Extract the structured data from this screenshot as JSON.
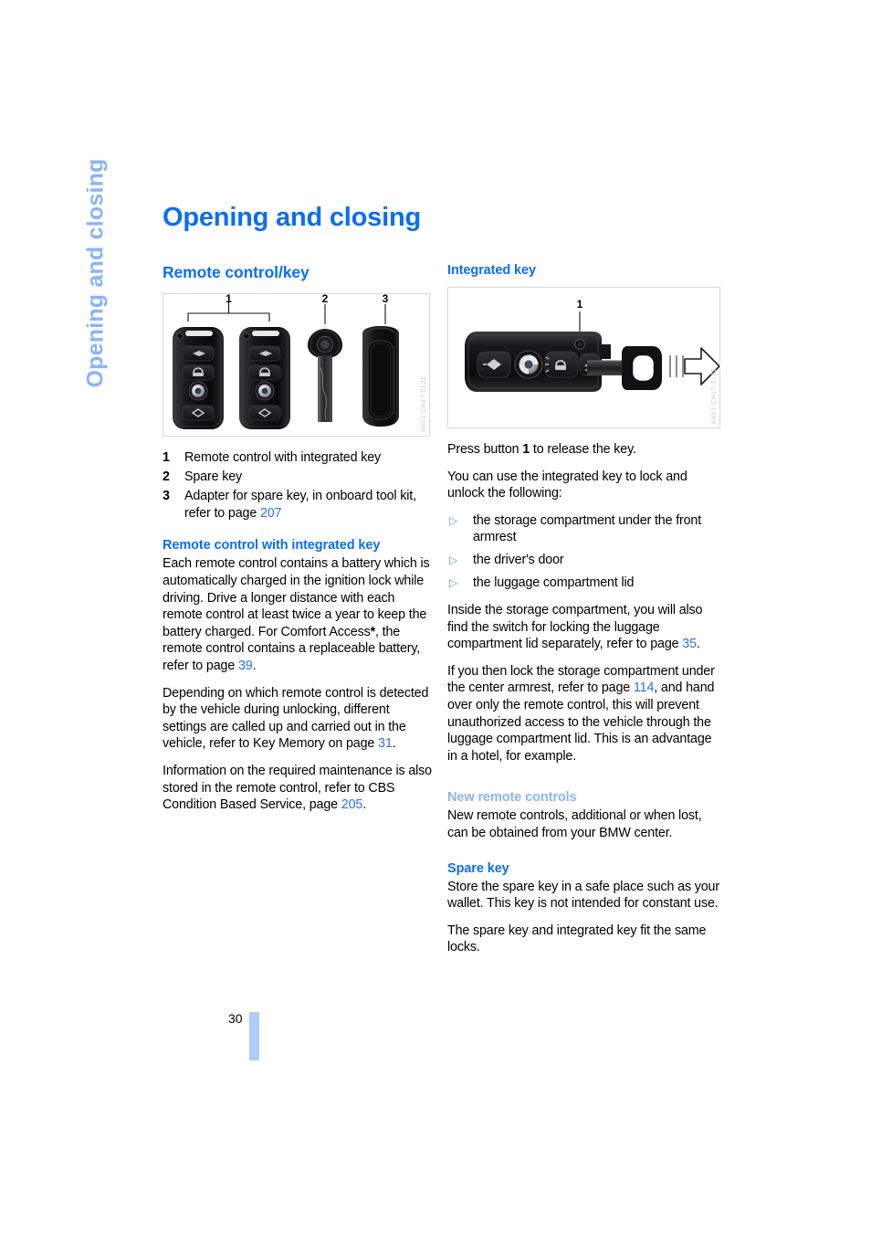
{
  "running_head": "Opening and closing",
  "page_title": "Opening and closing",
  "folio": "30",
  "left_column": {
    "section_heading": "Remote control/key",
    "figure": {
      "watermark": "VAV1 CH17 0121",
      "callouts": [
        "1",
        "2",
        "3"
      ],
      "alt": "Two remote controls with integrated key, a spare key and an adapter"
    },
    "legend": [
      {
        "num": "1",
        "text": "Remote control with integrated key"
      },
      {
        "num": "2",
        "text": "Spare key"
      },
      {
        "num": "3",
        "text": "Adapter for spare key, in onboard tool kit, refer to page ",
        "link": "207",
        "tail": ""
      }
    ],
    "subsection_heading": "Remote control with integrated key",
    "paragraphs": [
      {
        "parts": [
          {
            "t": "Each remote control contains a battery which is automatically charged in the ignition lock while driving. Drive a longer distance with each remote control at least twice a year to keep the battery charged. For Comfort Access"
          },
          {
            "t": "*",
            "style": "bold"
          },
          {
            "t": ", the remote control contains a replaceable battery, refer to page "
          },
          {
            "t": "39",
            "style": "link"
          },
          {
            "t": "."
          }
        ]
      },
      {
        "parts": [
          {
            "t": "Depending on which remote control is detected by the vehicle during unlocking, different settings are called up and carried out in the vehicle, refer to Key Memory on page "
          },
          {
            "t": "31",
            "style": "link"
          },
          {
            "t": "."
          }
        ]
      },
      {
        "parts": [
          {
            "t": "Information on the required maintenance is also stored in the remote control, refer to CBS Condition Based Service, page "
          },
          {
            "t": "205",
            "style": "link"
          },
          {
            "t": "."
          }
        ]
      }
    ]
  },
  "right_column": {
    "subsection_heading": "Integrated key",
    "figure": {
      "watermark": "VAV1 CH17 0122",
      "callouts": [
        "1"
      ],
      "alt": "Remote control with the integrated key being pulled out, arrow indicating direction"
    },
    "intro_paragraphs": [
      {
        "parts": [
          {
            "t": "Press button "
          },
          {
            "t": "1",
            "style": "bold"
          },
          {
            "t": " to release the key."
          }
        ]
      },
      {
        "parts": [
          {
            "t": "You can use the integrated key to lock and unlock the following:"
          }
        ]
      }
    ],
    "bullets": [
      "the storage compartment under the front armrest",
      "the driver's door",
      "the luggage compartment lid"
    ],
    "after_bullets": [
      {
        "parts": [
          {
            "t": "Inside the storage compartment, you will also find the switch for locking the luggage compartment lid separately, refer to page "
          },
          {
            "t": "35",
            "style": "link"
          },
          {
            "t": "."
          }
        ]
      },
      {
        "parts": [
          {
            "t": "If you then lock the storage compartment under the center armrest, refer to page "
          },
          {
            "t": "114",
            "style": "link"
          },
          {
            "t": ", and hand over only the remote control, this will prevent unauthorized access to the vehicle through the luggage compartment lid. This is an advantage in a hotel, for example."
          }
        ]
      }
    ],
    "new_remote_controls": {
      "heading": "New remote controls",
      "paragraphs": [
        {
          "parts": [
            {
              "t": "New remote controls, additional or when lost, can be obtained from your BMW center."
            }
          ]
        }
      ]
    },
    "spare_key": {
      "heading": "Spare key",
      "paragraphs": [
        {
          "parts": [
            {
              "t": "Store the spare key in a safe place such as your wallet. This key is not intended for constant use."
            }
          ]
        },
        {
          "parts": [
            {
              "t": "The spare key and integrated key fit the same locks."
            }
          ]
        }
      ]
    }
  },
  "colors": {
    "heading_blue": "#0a6ef5",
    "light_blue": "#8ab4f8",
    "link_blue": "#2a6ff0",
    "folio_bar": "#aecbfa",
    "figure_border": "#d9d9d9"
  }
}
